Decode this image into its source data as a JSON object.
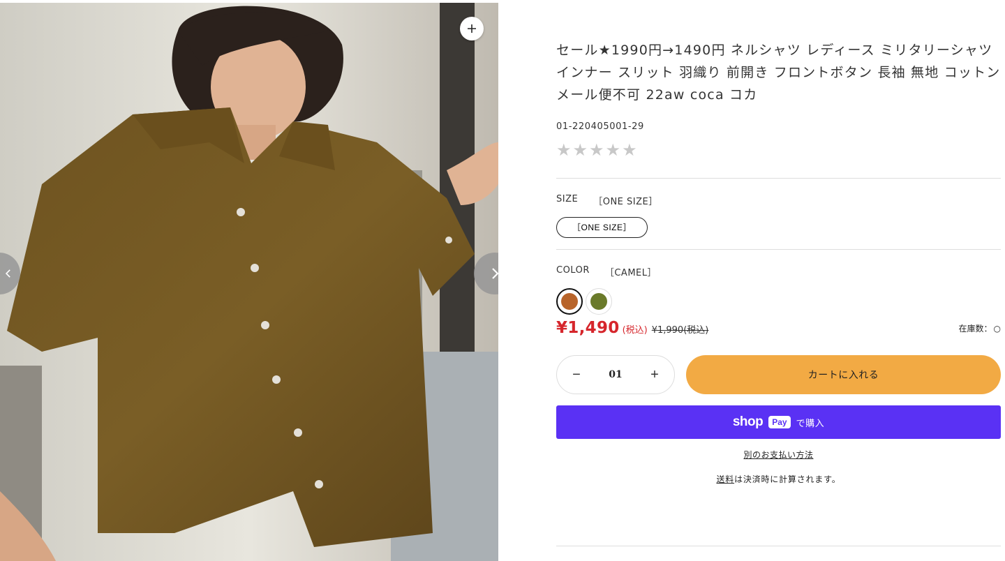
{
  "product": {
    "title": "セール★1990円→1490円 ネルシャツ レディース ミリタリーシャツ インナー スリット 羽織り 前開き フロントボタン 長袖 無地 コットン メール便不可 22aw coca コカ",
    "sku": "01-220405001-29",
    "rating_stars": 0,
    "rating_max": 5
  },
  "size": {
    "label": "SIZE",
    "selected": "［ONE SIZE］",
    "options": [
      "［ONE SIZE］"
    ]
  },
  "color": {
    "label": "COLOR",
    "selected": "［CAMEL］",
    "swatches": [
      {
        "name": "camel",
        "hex": "#b8642a",
        "selected": true
      },
      {
        "name": "khaki",
        "hex": "#6a7a2a",
        "selected": false
      }
    ]
  },
  "price": {
    "current": "¥1,490",
    "tax_note": "(税込)",
    "compare": "¥1,990(税込)",
    "stock_label": "在庫数：",
    "stock_symbol": "○"
  },
  "cart": {
    "quantity": "01",
    "minus": "−",
    "plus": "+",
    "add_label": "カートに入れる"
  },
  "shoppay": {
    "shop": "shop",
    "pay": "Pay",
    "buy": "で購入"
  },
  "more_payment": "別のお支払い方法",
  "shipping": {
    "link": "送料",
    "text": "は決済時に計算されます。"
  },
  "gallery": {
    "zoom": "+",
    "prev": "‹",
    "next": "›"
  },
  "colors": {
    "price_red": "#d6262c",
    "cart_orange": "#f2aa44",
    "shoppay_purple": "#5a31f4"
  }
}
